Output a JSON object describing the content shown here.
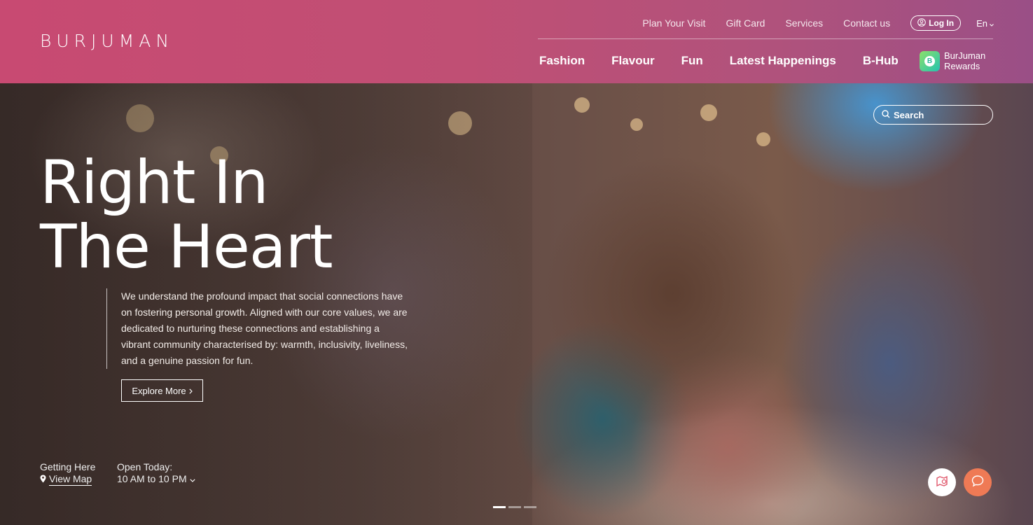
{
  "header": {
    "logo": "BURJUMAN",
    "util_nav": [
      "Plan Your Visit",
      "Gift Card",
      "Services",
      "Contact us"
    ],
    "login_label": "Log In",
    "language": "En",
    "main_nav": [
      "Fashion",
      "Flavour",
      "Fun",
      "Latest Happenings",
      "B-Hub"
    ],
    "rewards": {
      "line1": "BurJuman",
      "line2": "Rewards",
      "icon": "rewards-app-icon"
    }
  },
  "hero": {
    "title_line1": "Right In",
    "title_line2": "The Heart",
    "description": "We understand the profound impact that social connections have on fostering personal growth. Aligned with our core values, we are dedicated to nurturing these connections and establishing a vibrant community characterised by: warmth, inclusivity, liveliness, and a genuine passion for fun.",
    "cta_label": "Explore More",
    "search_label": "Search",
    "getting_here_label": "Getting Here",
    "view_map_label": "View Map",
    "open_today_label": "Open Today:",
    "hours": "10 AM to 10 PM",
    "carousel_total": 3,
    "carousel_active": 1
  },
  "colors": {
    "header_start": "#c84a72",
    "header_end": "#9a4f86",
    "chat_button": "#ef7a55"
  },
  "icons": [
    "user-icon",
    "chevron-down-icon",
    "search-icon",
    "location-pin-icon",
    "chevron-right-icon",
    "map-icon",
    "chat-icon"
  ]
}
